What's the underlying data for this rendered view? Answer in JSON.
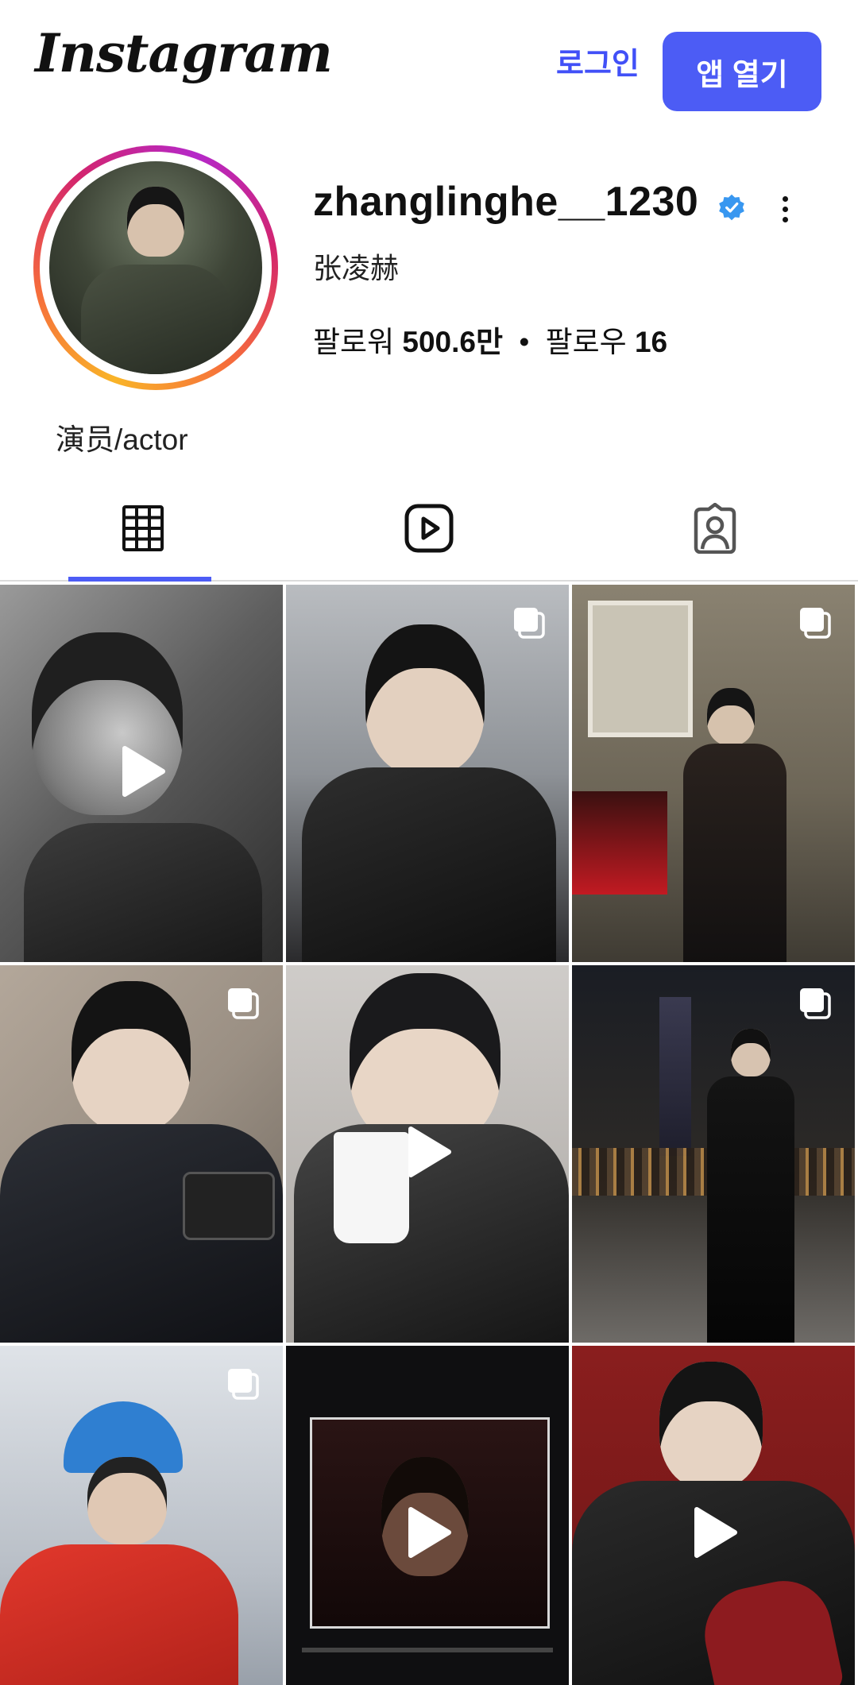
{
  "header": {
    "logo": "Instagram",
    "login_label": "로그인",
    "open_app_label": "앱 열기",
    "accent_color": "#4c5cf5"
  },
  "profile": {
    "username": "zhanglinghe__1230",
    "verified": true,
    "full_name": "张凌赫",
    "followers_label": "팔로워",
    "followers_count": "500.6만",
    "separator": "•",
    "following_label": "팔로우",
    "following_count": "16",
    "bio": "演员/actor"
  },
  "tabs": [
    {
      "name": "posts",
      "icon": "grid-icon",
      "active": true
    },
    {
      "name": "reels",
      "icon": "reels-icon",
      "active": false
    },
    {
      "name": "tagged",
      "icon": "tagged-icon",
      "active": false
    }
  ],
  "posts": [
    {
      "type": "reel",
      "icon": "play-icon"
    },
    {
      "type": "carousel",
      "icon": "multiple-photos-icon"
    },
    {
      "type": "carousel",
      "icon": "multiple-photos-icon"
    },
    {
      "type": "carousel",
      "icon": "multiple-photos-icon"
    },
    {
      "type": "reel",
      "icon": "play-icon"
    },
    {
      "type": "carousel",
      "icon": "multiple-photos-icon"
    },
    {
      "type": "carousel",
      "icon": "multiple-photos-icon"
    },
    {
      "type": "reel",
      "icon": "play-icon"
    },
    {
      "type": "reel",
      "icon": "play-icon"
    }
  ]
}
